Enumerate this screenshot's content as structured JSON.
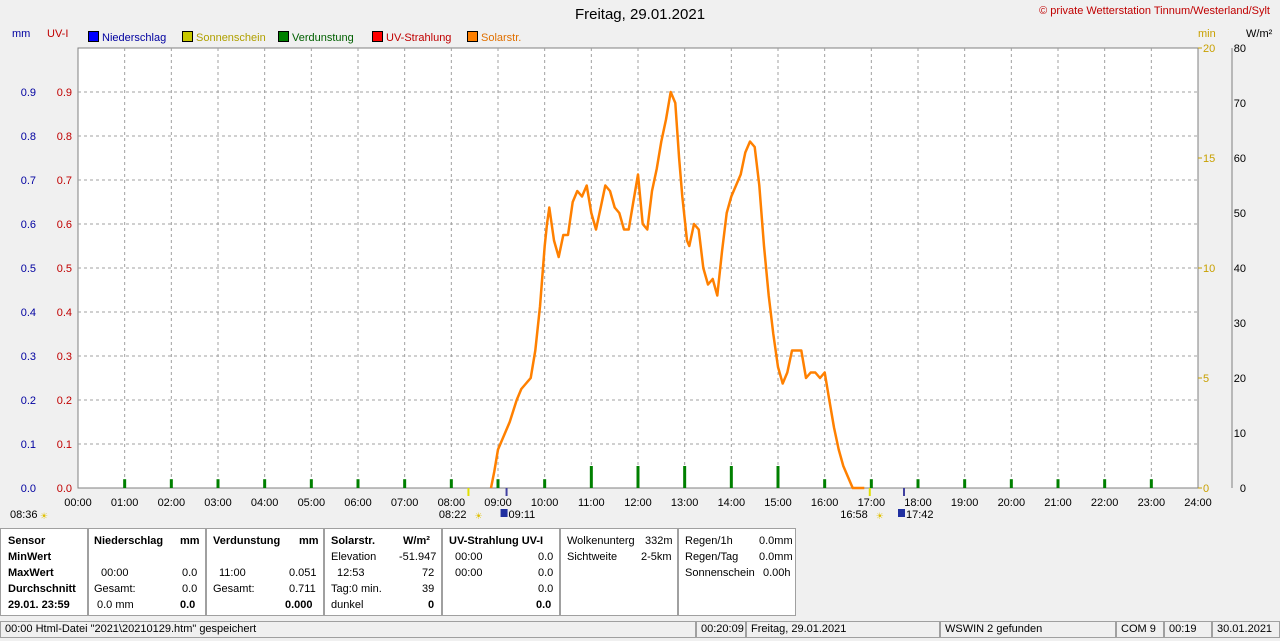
{
  "title": "Freitag, 29.01.2021",
  "copyright": "© private Wetterstation Tinnum/Westerland/Sylt",
  "axis_units": {
    "left1": "mm",
    "left2": "UV-I",
    "right1": "min",
    "right2": "W/m²"
  },
  "legend": [
    {
      "label": "Niederschlag",
      "color": "#0000ff"
    },
    {
      "label": "Sonnenschein",
      "color": "#c8c800"
    },
    {
      "label": "Verdunstung",
      "color": "#008000"
    },
    {
      "label": "UV-Strahlung",
      "color": "#ff0000"
    },
    {
      "label": "Solarstr.",
      "color": "#ff8000"
    }
  ],
  "colors": {
    "solar": "#ff8000",
    "evap": "#008000",
    "left_axis": "#0000a0",
    "uv_axis": "#c00000",
    "min_axis": "#c8a000",
    "grid": "#a0a0a0"
  },
  "chart_data": {
    "type": "line",
    "x_unit": "time of day (hours)",
    "xlim": [
      0,
      24
    ],
    "x_ticks": [
      "00:00",
      "01:00",
      "02:00",
      "03:00",
      "04:00",
      "05:00",
      "06:00",
      "07:00",
      "08:00",
      "09:00",
      "10:00",
      "11:00",
      "12:00",
      "13:00",
      "14:00",
      "15:00",
      "16:00",
      "17:00",
      "18:00",
      "19:00",
      "20:00",
      "21:00",
      "22:00",
      "23:00",
      "24:00"
    ],
    "y_left_ticks": [
      "0.0",
      "0.1",
      "0.2",
      "0.3",
      "0.4",
      "0.5",
      "0.6",
      "0.7",
      "0.8",
      "0.9"
    ],
    "ylim_left": [
      0,
      1.0
    ],
    "y_min_ticks": [
      "0",
      "5",
      "10",
      "15",
      "20"
    ],
    "ylim_min": [
      0,
      20
    ],
    "y_wm2_ticks": [
      "0",
      "10",
      "20",
      "30",
      "40",
      "50",
      "60",
      "70",
      "80"
    ],
    "ylim_wm2": [
      0,
      80
    ],
    "series": [
      {
        "name": "Solarstr.",
        "unit": "W/m²",
        "x": [
          8.85,
          8.92,
          9.0,
          9.1,
          9.25,
          9.4,
          9.5,
          9.6,
          9.7,
          9.8,
          9.9,
          10.0,
          10.05,
          10.1,
          10.2,
          10.3,
          10.4,
          10.5,
          10.6,
          10.7,
          10.8,
          10.9,
          11.0,
          11.1,
          11.2,
          11.3,
          11.4,
          11.5,
          11.6,
          11.7,
          11.8,
          11.9,
          12.0,
          12.1,
          12.2,
          12.3,
          12.4,
          12.5,
          12.6,
          12.7,
          12.8,
          12.88,
          12.95,
          13.05,
          13.1,
          13.2,
          13.3,
          13.4,
          13.5,
          13.6,
          13.7,
          13.8,
          13.9,
          14.0,
          14.1,
          14.2,
          14.3,
          14.4,
          14.5,
          14.6,
          14.7,
          14.8,
          14.9,
          15.0,
          15.1,
          15.2,
          15.3,
          15.4,
          15.5,
          15.6,
          15.7,
          15.8,
          15.9,
          16.0,
          16.1,
          16.2,
          16.3,
          16.4,
          16.5,
          16.6,
          16.7,
          16.75,
          16.8,
          16.85
        ],
        "y": [
          0,
          3,
          7,
          9,
          12,
          16,
          18,
          19,
          20,
          25,
          33,
          44,
          48,
          51,
          45,
          42,
          46,
          46,
          52,
          54,
          53,
          55,
          50,
          47,
          51,
          55,
          54,
          51,
          50,
          47,
          47,
          52,
          57,
          48,
          47,
          54,
          58,
          63,
          67,
          72,
          70,
          60,
          53,
          45,
          44,
          48,
          47,
          40,
          37,
          38,
          35,
          43,
          50,
          53,
          55,
          57,
          61,
          63,
          62,
          55,
          44,
          35,
          28,
          22,
          19,
          21,
          25,
          25,
          25,
          20,
          21,
          21,
          20,
          21,
          16,
          11,
          7,
          4,
          2,
          0,
          0,
          0,
          0,
          0
        ]
      },
      {
        "name": "Verdunstung",
        "unit": "mm",
        "x": [
          1,
          2,
          3,
          4,
          5,
          6,
          7,
          8,
          9,
          10,
          11,
          12,
          13,
          14,
          15,
          16,
          17,
          18,
          19,
          20,
          21,
          22,
          23
        ],
        "y": [
          0.02,
          0.02,
          0.02,
          0.02,
          0.02,
          0.02,
          0.02,
          0.02,
          0.02,
          0.02,
          0.05,
          0.05,
          0.05,
          0.05,
          0.05,
          0.02,
          0.02,
          0.02,
          0.02,
          0.02,
          0.02,
          0.02,
          0.02
        ]
      }
    ],
    "markers": [
      {
        "time": "08:22",
        "label": "08:22"
      },
      {
        "time": "09:11",
        "label": "09:11"
      },
      {
        "time": "16:58",
        "label": "16:58"
      },
      {
        "time": "17:42",
        "label": "17:42"
      }
    ],
    "left_marker_label": "08:36"
  },
  "table": {
    "sensor": {
      "h": "Sensor",
      "r1": "MinWert",
      "r2": "MaxWert",
      "r3": "Durchschnitt",
      "r4": "29.01. 23:59"
    },
    "nied": {
      "h": "Niederschlag",
      "u": "mm",
      "t1": "00:00",
      "v1": "0.0",
      "t2": "Gesamt:",
      "v2": "0.0",
      "t3": "0.0 mm",
      "v3": "0.0"
    },
    "verd": {
      "h": "Verdunstung",
      "u": "mm",
      "t1": "11:00",
      "v1": "0.051",
      "t2": "Gesamt:",
      "v2": "0.711",
      "v3": "0.000"
    },
    "solar": {
      "h": "Solarstr.",
      "u": "W/m²",
      "r0l": "Elevation",
      "r0v": "-51.947",
      "t1": "12:53",
      "v1": "72",
      "t2": "Tag:0 min.",
      "v2": "39",
      "t3": "dunkel",
      "v3": "0"
    },
    "uv": {
      "h": "UV-Strahlung UV-I",
      "t0": "00:00",
      "v0": "0.0",
      "t1": "00:00",
      "v1": "0.0",
      "v2": "0.0",
      "v3": "0.0"
    },
    "wolken": {
      "l1": "Wolkenunterg",
      "v1": "332m",
      "l2": "Sichtweite",
      "v2": "2-5km"
    },
    "regen": {
      "l1": "Regen/1h",
      "v1": "0.0mm",
      "l2": "Regen/Tag",
      "v2": "0.0mm",
      "l3": "Sonnenschein",
      "v3": "0.00h"
    }
  },
  "status": {
    "s1": "00:00  Html-Datei  \"2021\\20210129.htm\"  gespeichert",
    "s2": "00:20:09",
    "s3": "Freitag, 29.01.2021",
    "s4": "WSWIN 2 gefunden",
    "s5": "COM 9",
    "s6": "00:19",
    "s7": "30.01.2021"
  }
}
